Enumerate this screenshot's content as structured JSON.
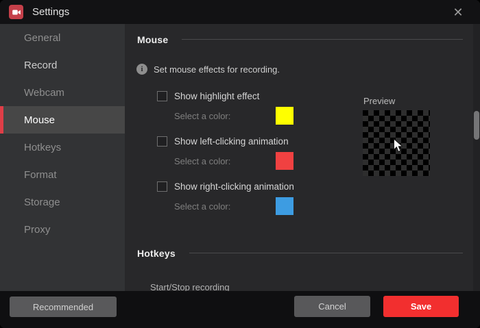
{
  "window": {
    "title": "Settings",
    "close_glyph": "✕"
  },
  "colors": {
    "logo_red": "#c5404a",
    "accent_red": "#df3e47",
    "save_red": "#f22f2f"
  },
  "sidebar": {
    "items": [
      {
        "label": "General"
      },
      {
        "label": "Record",
        "bright": true
      },
      {
        "label": "Webcam"
      },
      {
        "label": "Mouse",
        "selected": true
      },
      {
        "label": "Hotkeys"
      },
      {
        "label": "Format"
      },
      {
        "label": "Storage"
      },
      {
        "label": "Proxy"
      }
    ]
  },
  "mouse_section": {
    "heading": "Mouse",
    "info_text": "Set mouse effects for recording.",
    "info_glyph": "i",
    "options": [
      {
        "label": "Show highlight effect",
        "color_label": "Select a color:",
        "color": "#ffff00",
        "checked": false
      },
      {
        "label": "Show left-clicking animation",
        "color_label": "Select a color:",
        "color": "#f04141",
        "checked": false
      },
      {
        "label": "Show right-clicking animation",
        "color_label": "Select a color:",
        "color": "#3d9ce2",
        "checked": false
      }
    ],
    "preview": {
      "label": "Preview",
      "checker_dark": "#000000",
      "checker_light": "#2e2e2e"
    }
  },
  "hotkeys_section": {
    "heading": "Hotkeys",
    "first_item_label": "Start/Stop recording"
  },
  "footer": {
    "recommended_label": "Recommended",
    "cancel_label": "Cancel",
    "save_label": "Save"
  }
}
